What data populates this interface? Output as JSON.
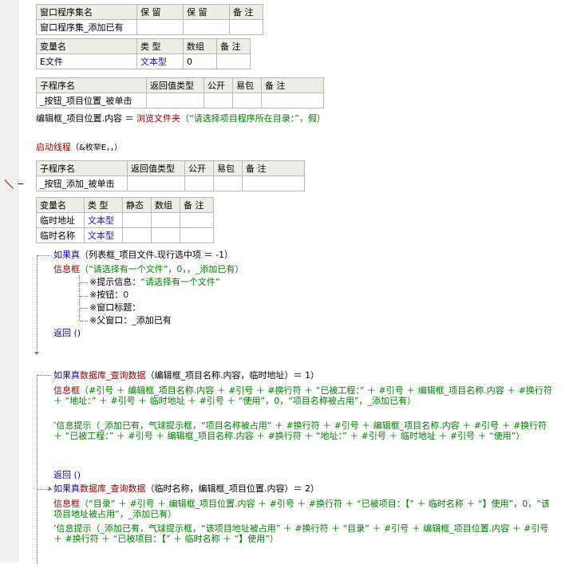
{
  "window_table": {
    "headers": [
      "窗口程序集名",
      "保 留",
      "保 留",
      "备 注"
    ],
    "row": [
      "窗口程序集_添加已有",
      "",
      "",
      ""
    ]
  },
  "var_table": {
    "headers": [
      "变量名",
      "类 型",
      "数组",
      "备 注"
    ],
    "row": [
      "E文件",
      "文本型",
      "0",
      ""
    ]
  },
  "sub1_table": {
    "headers": [
      "子程序名",
      "返回值类型",
      "公开",
      "易包",
      "备 注"
    ],
    "row": [
      "_按钮_项目位置_被单击",
      "",
      "",
      "",
      ""
    ]
  },
  "sub1_code": {
    "lhs": "编辑框_项目位置.内容 ＝ ",
    "func": "浏览文件夹",
    "args": "（“请选择项目程序所在目录：”，假）"
  },
  "thread_line": {
    "func": "启动线程",
    "args": "（&枚举E，，）"
  },
  "sub2_table": {
    "headers": [
      "子程序名",
      "返回值类型",
      "公开",
      "易包",
      "备 注"
    ],
    "row": [
      "_按钮_添加_被单击",
      "",
      "",
      "",
      ""
    ]
  },
  "local_table": {
    "headers": [
      "变量名",
      "类 型",
      "静态",
      "数组",
      "备 注"
    ],
    "rows": [
      [
        "临时地址",
        "文本型",
        "",
        "",
        ""
      ],
      [
        "临时名称",
        "文本型",
        "",
        "",
        ""
      ]
    ]
  },
  "if1": {
    "kw": "如果真",
    "cond": "（列表框_项目文件.现行选中项 ＝ -1）",
    "msg_func": "信息框",
    "msg_args": "（“请选择有一个文件”，0，，_添加已有）",
    "params": [
      {
        "label": "※提示信息：",
        "value": "“请选择有一个文件”"
      },
      {
        "label": "※按钮：",
        "value": "0"
      },
      {
        "label": "※窗口标题：",
        "value": ""
      },
      {
        "label": "※父窗口：",
        "value": "_添加已有"
      }
    ],
    "ret": "返回 ()"
  },
  "if2": {
    "kw": "如果真",
    "func": "数据库_查询数据",
    "cond": "（编辑框_项目名称.内容，临时地址）＝ 1）",
    "msg_func": "信息框",
    "msg_args": "（#引号 ＋ 编辑框_项目名称.内容 ＋ #引号 ＋ #换行符 ＋ “已被工程：” ＋ #引号 ＋ 编辑框_项目名称.内容 ＋ #换行符 ＋ “地址：” ＋ #引号 ＋ 临时地址 ＋ #引号 ＋ “使用”，0，“项目名称被占用”，_添加已有）",
    "comment": "’信息提示（_添加已有，气球提示框，“项目名称被占用” ＋ #换行符 ＋ #引号 ＋ 编辑框_项目名称.内容 ＋ #引号 ＋ #换行符 ＋ “已被工程：” ＋ #引号 ＋ 编辑框_项目名称.内容 ＋ #换行符 ＋ “地址：” ＋ #引号 ＋ 临时地址 ＋ #引号 ＋ “使用”）",
    "ret": "返回 ()"
  },
  "if3": {
    "kw": "如果真",
    "func": "数据库_查询数据",
    "cond": "（临时名称，编辑框_项目位置.内容）＝ 2）",
    "msg_func": "信息框",
    "msg_args": "（“目录” ＋ #引号 ＋ 编辑框_项目位置.内容 ＋ #引号 ＋ #换行符 ＋ “已被项目：【” ＋ 临时名称 ＋ “】使用”，0，“该项目地址被占用”，_添加已有）",
    "comment": "’信息提示（_添加已有，气球提示框，“该项目地址被占用” ＋ #换行符 ＋ “目录” ＋ #引号 ＋ 编辑框_项目位置.内容 ＋ #引号 ＋ #换行符 ＋ “已被项目：【” ＋ 临时名称 ＋ “】使用”）"
  },
  "colors": {
    "keyword": "#0a0ac0",
    "function": "#a00000",
    "string": "#008000",
    "comment": "#008000",
    "header_bg": "#ebefe5",
    "type_text": "#1a1ac8"
  },
  "icons": {
    "breakpoint": "pen-icon"
  }
}
